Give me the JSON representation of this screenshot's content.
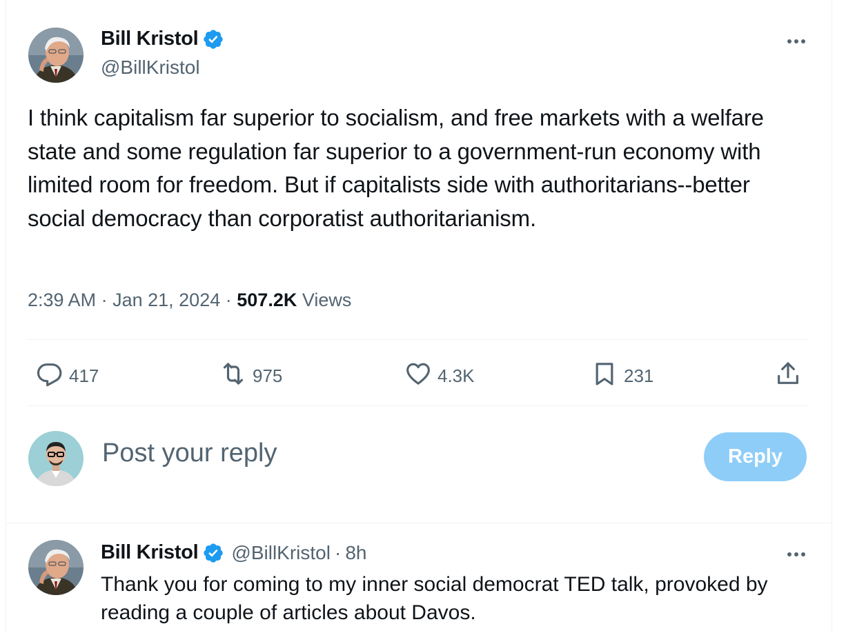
{
  "tweet": {
    "author": {
      "display_name": "Bill Kristol",
      "handle": "@BillKristol",
      "verified": true
    },
    "text": "I think capitalism far superior to socialism, and free markets with a welfare state and some regulation far superior to a government-run economy with limited room for freedom. But if capitalists side with authoritarians--better social democracy than corporatist authoritarianism.",
    "time": "2:39 AM",
    "date": "Jan 21, 2024",
    "separator": "·",
    "views_count": "507.2K",
    "views_label": "Views",
    "actions": {
      "replies": "417",
      "reposts": "975",
      "likes": "4.3K",
      "bookmarks": "231"
    }
  },
  "reply_box": {
    "placeholder": "Post your reply",
    "button_label": "Reply"
  },
  "thread_reply": {
    "author": {
      "display_name": "Bill Kristol",
      "handle": "@BillKristol",
      "verified": true
    },
    "separator": "·",
    "time_ago": "8h",
    "text": "Thank you for coming to my inner social democrat TED talk, provoked by reading a couple of articles about Davos."
  },
  "icons": {
    "verified": "verified-badge-icon",
    "more": "more-options-icon",
    "reply": "reply-icon",
    "repost": "repost-icon",
    "like": "heart-icon",
    "bookmark": "bookmark-icon",
    "share": "share-icon"
  },
  "colors": {
    "verified_blue": "#1d9bf0",
    "text_primary": "#0f1419",
    "text_secondary": "#536471",
    "reply_button_disabled": "#8ecdf8",
    "divider": "#eff3f4"
  }
}
